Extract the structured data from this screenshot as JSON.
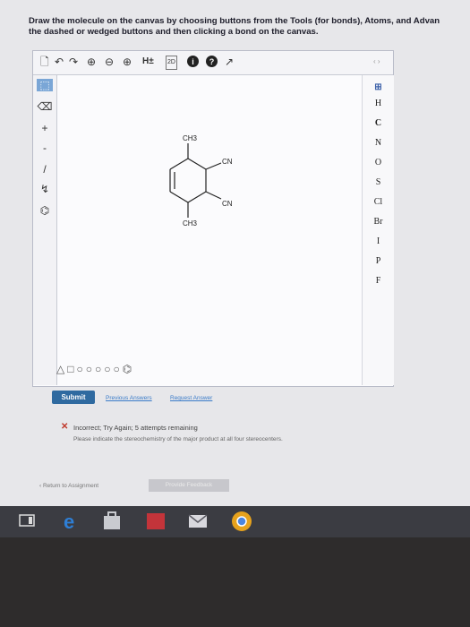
{
  "instructions": {
    "line1": "Draw the molecule on the canvas by choosing buttons from the Tools (for bonds), Atoms, and Advan",
    "line2": "the dashed or wedged buttons and then clicking a bond on the canvas."
  },
  "toolbar": {
    "new": "🗋",
    "undo": "↶",
    "redo": "↷",
    "zoom_in": "⊕",
    "zoom_out": "⊖",
    "zoom_fit": "⊕",
    "hs_label": "H±",
    "label_2d": "2D",
    "info": "i",
    "help": "?",
    "expand": "↗"
  },
  "tools": {
    "select": "⬚",
    "erase": "⌫",
    "plus": "+",
    "minus": "-",
    "bond": "/",
    "chain": "↯",
    "template": "⌬"
  },
  "atoms": [
    "H",
    "C",
    "N",
    "O",
    "S",
    "Cl",
    "Br",
    "I",
    "P",
    "F"
  ],
  "atoms_expand": "‹ ›",
  "molecule": {
    "top_label": "CH3",
    "right_top_label": "CN",
    "right_bottom_label": "CN",
    "bottom_label": "CH3"
  },
  "shapes": "△□○○○○○⌬",
  "actions": {
    "submit": "Submit",
    "previous": "Previous Answers",
    "request": "Request Answer"
  },
  "feedback": {
    "icon": "✕",
    "title": "Incorrect; Try Again; 5 attempts remaining",
    "detail": "Please indicate the stereochemistry of the major product at all four stereocenters."
  },
  "footer": {
    "return": "‹ Return to Assignment",
    "provide_feedback": "Provide Feedback"
  },
  "taskbar": {
    "icons": [
      "tablet-mode-icon",
      "edge-icon",
      "store-icon",
      "office-icon",
      "mail-icon",
      "chrome-icon"
    ]
  }
}
